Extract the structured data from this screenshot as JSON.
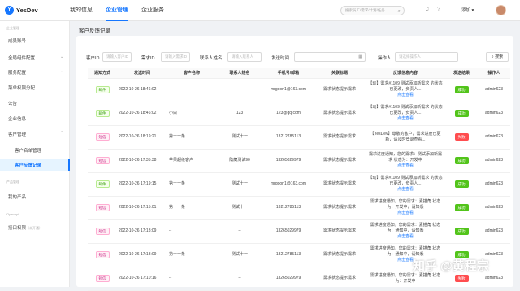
{
  "app": {
    "logo_letter": "Y",
    "name": "YesDev"
  },
  "nav": [
    "我的信息",
    "企业管理",
    "企业服务"
  ],
  "search": {
    "placeholder": "搜索员工/需求/计划/任务…"
  },
  "user": {
    "name": "添加 ▾"
  },
  "sidebar": {
    "group1": "企业管理",
    "items": [
      "成员账号",
      "全局组件配置",
      "服务配置",
      "菜单权限分配",
      "公告",
      "企业信息",
      "客户管理"
    ],
    "sub": [
      "客户名单管理",
      "客户反馈记录"
    ],
    "group2": "产品管理",
    "my_products": "我的产品",
    "group3": "Openapi",
    "api": "接口权限",
    "api_hint": "（未开通）"
  },
  "breadcrumb": "客户反馈记录",
  "filters": {
    "customer_id": "客户ID",
    "customer_id_ph": "请输入客户ID",
    "demand_id": "需求ID",
    "demand_id_ph": "请输入需求ID",
    "contact": "联系人姓名",
    "contact_ph": "请输入联系人",
    "send_time": "发送时间",
    "operator": "操作人",
    "operator_ph": "请选择操作人",
    "search_btn": "搜索"
  },
  "columns": [
    "通知方式",
    "发送时间",
    "客户名称",
    "联系人姓名",
    "手机号/邮箱",
    "关联标题",
    "反馈信息内容",
    "发送结果",
    "操作人"
  ],
  "rows": [
    {
      "type": "邮件",
      "tag": "g",
      "time": "2022-10-26 18:46:02",
      "customer": "--",
      "contact": "--",
      "phone": "mrgoon1@163.com",
      "title": "需求状态提示需求",
      "content": "【动】需求#1109 测试添加新需求 的状态已更改，负责人...",
      "link": "点击查看",
      "result": "成功",
      "res": "ok",
      "op": "admin623"
    },
    {
      "type": "邮件",
      "tag": "g",
      "time": "2022-10-26 18:46:02",
      "customer": "小白",
      "contact": "123",
      "phone": "123@qq.com",
      "title": "需求状态提示需求",
      "content": "【动】需求#1109 测试添加新需求 的状态已更改，负责人...",
      "link": "点击查看",
      "result": "成功",
      "res": "ok",
      "op": "admin623"
    },
    {
      "type": "短信",
      "tag": "p",
      "time": "2022-10-26 18:19:21",
      "customer": "第十一条",
      "contact": "测试十一",
      "phone": "13212785113",
      "title": "需求状态提示需求",
      "content": "【YesDev】尊敬的客户，需求进度已更新，请及时登录查看...",
      "link": "",
      "result": "失败",
      "res": "fail",
      "op": "admin623"
    },
    {
      "type": "短信",
      "tag": "p",
      "time": "2022-10-26 17:35:38",
      "customer": "苹果超级客户",
      "contact": "隐藏测试90",
      "phone": "13265029979",
      "title": "需求状态提示需求",
      "content": "需求进度通知，您的需求：测试添加新需求 状态为：开发中",
      "link": "点击查看",
      "result": "成功",
      "res": "ok",
      "op": "admin623"
    },
    {
      "type": "邮件",
      "tag": "g",
      "time": "2022-10-26 17:19:15",
      "customer": "第十一条",
      "contact": "测试十一",
      "phone": "mrgoon1@163.com",
      "title": "需求状态提示需求",
      "content": "【动】需求#1109 测试添加新需求 的状态已更改，负责人...",
      "link": "点击查看",
      "result": "成功",
      "res": "ok",
      "op": "admin623"
    },
    {
      "type": "短信",
      "tag": "p",
      "time": "2022-10-26 17:15:01",
      "customer": "第十一条",
      "contact": "测试十一",
      "phone": "13212785113",
      "title": "需求状态提示需求",
      "content": "需求进度通知，您的需求：素描角 状态为：开发中，请知悉",
      "link": "点击查看",
      "result": "成功",
      "res": "ok",
      "op": "admin623"
    },
    {
      "type": "短信",
      "tag": "p",
      "time": "2022-10-26 17:13:09",
      "customer": "--",
      "contact": "--",
      "phone": "13265029979",
      "title": "需求状态提示需求",
      "content": "需求进度通知，您的需求：素描角 状态为：通知中，请知悉",
      "link": "点击查看",
      "result": "成功",
      "res": "ok",
      "op": "admin623"
    },
    {
      "type": "短信",
      "tag": "p",
      "time": "2022-10-26 17:13:09",
      "customer": "第十一条",
      "contact": "测试十一",
      "phone": "13212785113",
      "title": "需求状态提示需求",
      "content": "需求进度通知，您的需求：素描角 状态为：通知中，请知悉",
      "link": "点击查看",
      "result": "成功",
      "res": "ok",
      "op": "admin623"
    },
    {
      "type": "短信",
      "tag": "p",
      "time": "2022-10-26 17:10:16",
      "customer": "--",
      "contact": "--",
      "phone": "13265029979",
      "title": "需求状态提示需求",
      "content": "需求进度通知，您的需求：素描角 状态为：开发中",
      "link": "",
      "result": "失败",
      "res": "fail",
      "op": "admin623"
    }
  ],
  "watermark": "知乎 @黄程宗"
}
